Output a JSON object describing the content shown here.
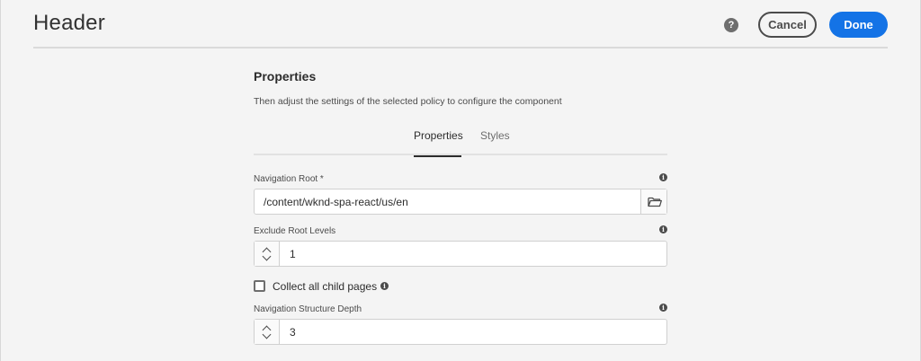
{
  "header": {
    "title": "Header",
    "help_icon": "?",
    "cancel_label": "Cancel",
    "done_label": "Done",
    "accent_color": "#1473e6"
  },
  "properties": {
    "title": "Properties",
    "description": "Then adjust the settings of the selected policy to configure the component",
    "tabs": [
      {
        "label": "Properties",
        "active": true
      },
      {
        "label": "Styles",
        "active": false
      }
    ],
    "navigation_root": {
      "label": "Navigation Root *",
      "value": "/content/wknd-spa-react/us/en",
      "browse_icon": "folder-icon"
    },
    "exclude_root_levels": {
      "label": "Exclude Root Levels",
      "value": "1"
    },
    "collect_all_child_pages": {
      "label": "Collect all child pages",
      "checked": false
    },
    "navigation_structure_depth": {
      "label": "Navigation Structure Depth",
      "value": "3"
    },
    "info_icon": "i"
  }
}
